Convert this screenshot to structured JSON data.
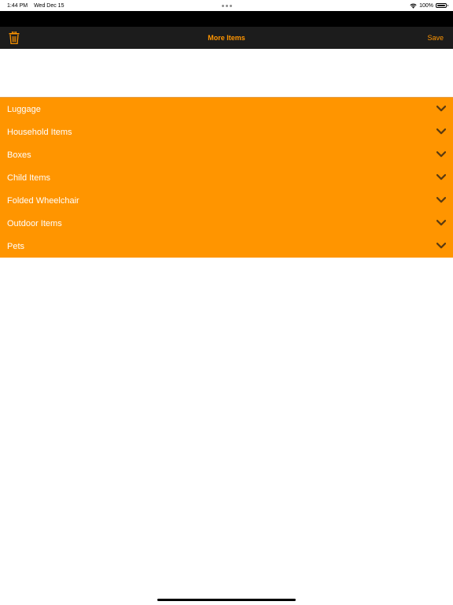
{
  "status_bar": {
    "time": "1:44 PM",
    "date": "Wed Dec 15",
    "battery": "100%",
    "battery_level": 1.0
  },
  "nav": {
    "title": "More Items",
    "save_label": "Save",
    "left_icon": "trash-icon"
  },
  "categories": [
    {
      "label": "Luggage",
      "icon": "chevron-down-icon"
    },
    {
      "label": "Household Items",
      "icon": "chevron-down-icon"
    },
    {
      "label": "Boxes",
      "icon": "chevron-down-icon"
    },
    {
      "label": "Child Items",
      "icon": "chevron-down-icon"
    },
    {
      "label": "Folded Wheelchair",
      "icon": "chevron-down-icon"
    },
    {
      "label": "Outdoor Items",
      "icon": "chevron-down-icon"
    },
    {
      "label": "Pets",
      "icon": "chevron-down-icon"
    }
  ],
  "colors": {
    "accent": "#ff9500",
    "nav_background": "#1c1c1c",
    "list_text": "#ffffff",
    "chevron": "#5a3a10"
  }
}
